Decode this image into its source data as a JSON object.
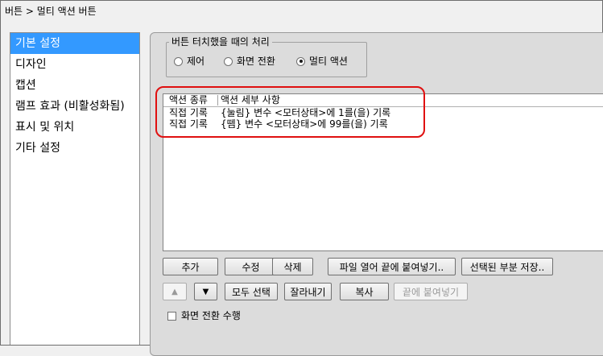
{
  "window": {
    "breadcrumb": "버튼 > 멀티 액션 버튼"
  },
  "sidebar": {
    "items": [
      {
        "label": "기본 설정",
        "selected": true
      },
      {
        "label": "디자인"
      },
      {
        "label": "캡션"
      },
      {
        "label": "램프 효과 (비활성화됨)"
      },
      {
        "label": "표시 및 위치"
      },
      {
        "label": "기타 설정"
      }
    ]
  },
  "touch_group": {
    "title": "버튼 터치했을 때의 처리",
    "options": [
      {
        "label": "제어",
        "checked": false
      },
      {
        "label": "화면 전환",
        "checked": false
      },
      {
        "label": "멀티 액션",
        "checked": true
      }
    ]
  },
  "action_list": {
    "columns": [
      "액션 종류",
      "액션 세부 사항"
    ],
    "rows": [
      {
        "type": "직접 기록",
        "detail": "{눌림} 변수 <모터상태>에 1를(을) 기록"
      },
      {
        "type": "직접 기록",
        "detail": "{뗌} 변수 <모터상태>에 99를(을) 기록"
      }
    ]
  },
  "buttons": {
    "add": "추가",
    "edit": "수정",
    "delete": "삭제",
    "append_file": "파일 열어 끝에 붙여넣기..",
    "save_selected": "선택된 부분 저장..",
    "move_up": "▲",
    "move_down": "▼",
    "select_all": "모두 선택",
    "cut": "잘라내기",
    "copy": "복사",
    "paste_end": "끝에 붙여넣기"
  },
  "options": {
    "screen_switch_label": "화면 전환 수행",
    "screen_switch_checked": false
  },
  "colors": {
    "selection": "#3399ff",
    "highlight": "#e01010"
  }
}
